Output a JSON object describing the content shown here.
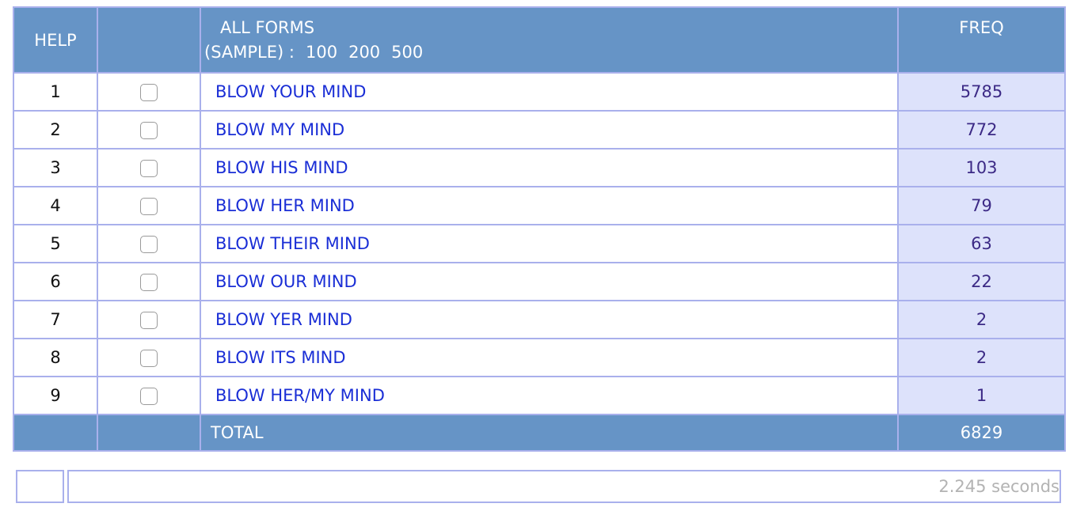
{
  "header": {
    "help": "HELP",
    "all_forms": "ALL FORMS",
    "sample_label": "(SAMPLE) :",
    "sample_options": [
      "100",
      "200",
      "500"
    ],
    "freq": "FREQ"
  },
  "rows": [
    {
      "n": "1",
      "form": "BLOW YOUR MIND",
      "freq": "5785"
    },
    {
      "n": "2",
      "form": "BLOW MY MIND",
      "freq": "772"
    },
    {
      "n": "3",
      "form": "BLOW HIS MIND",
      "freq": "103"
    },
    {
      "n": "4",
      "form": "BLOW HER MIND",
      "freq": "79"
    },
    {
      "n": "5",
      "form": "BLOW THEIR MIND",
      "freq": "63"
    },
    {
      "n": "6",
      "form": "BLOW OUR MIND",
      "freq": "22"
    },
    {
      "n": "7",
      "form": "BLOW YER MIND",
      "freq": "2"
    },
    {
      "n": "8",
      "form": "BLOW ITS MIND",
      "freq": "2"
    },
    {
      "n": "9",
      "form": "BLOW HER/MY MIND",
      "freq": "1"
    }
  ],
  "total": {
    "label": "TOTAL",
    "value": "6829"
  },
  "footer": {
    "timing": "2.245 seconds"
  },
  "colors": {
    "header_bg": "#6694c6",
    "border": "#a9b0ec",
    "freq_bg": "#dde2fb",
    "link": "#1a2ed6"
  }
}
